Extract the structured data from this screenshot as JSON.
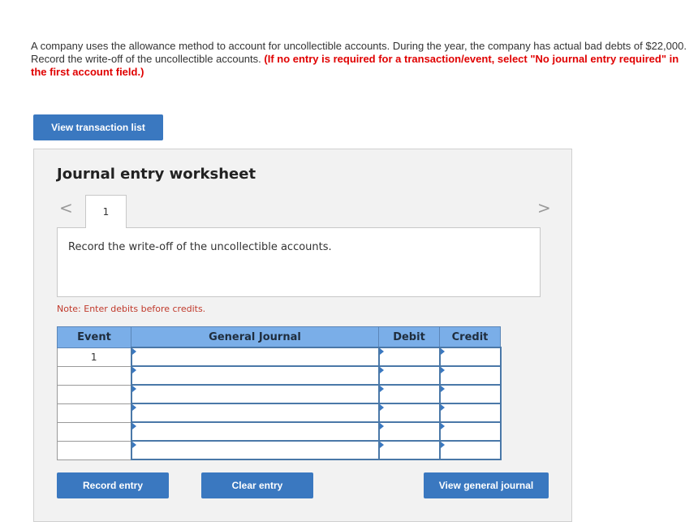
{
  "question": {
    "line1": "A company uses the allowance method to account for uncollectible accounts. During the year, the company has actual bad debts of $22,000.",
    "line2": "Record the write-off of the uncollectible accounts.",
    "instruction": "(If no entry is required for a transaction/event, select \"No journal entry required\" in the first account field.)"
  },
  "buttons": {
    "view_transaction_list": "View transaction list",
    "record_entry": "Record entry",
    "clear_entry": "Clear entry",
    "view_general_journal": "View general journal"
  },
  "worksheet": {
    "title": "Journal entry worksheet",
    "prev_arrow": "<",
    "next_arrow": ">",
    "tab_label": "1",
    "description": "Record the write-off of the uncollectible accounts.",
    "note": "Note: Enter debits before credits."
  },
  "journal": {
    "headers": {
      "event": "Event",
      "general_journal": "General Journal",
      "debit": "Debit",
      "credit": "Credit"
    },
    "rows": [
      {
        "event": "1",
        "account": "",
        "debit": "",
        "credit": ""
      },
      {
        "event": "",
        "account": "",
        "debit": "",
        "credit": ""
      },
      {
        "event": "",
        "account": "",
        "debit": "",
        "credit": ""
      },
      {
        "event": "",
        "account": "",
        "debit": "",
        "credit": ""
      },
      {
        "event": "",
        "account": "",
        "debit": "",
        "credit": ""
      },
      {
        "event": "",
        "account": "",
        "debit": "",
        "credit": ""
      }
    ]
  },
  "colors": {
    "button": "#3a78c0",
    "header": "#7aaee8",
    "warning": "#e00000"
  }
}
